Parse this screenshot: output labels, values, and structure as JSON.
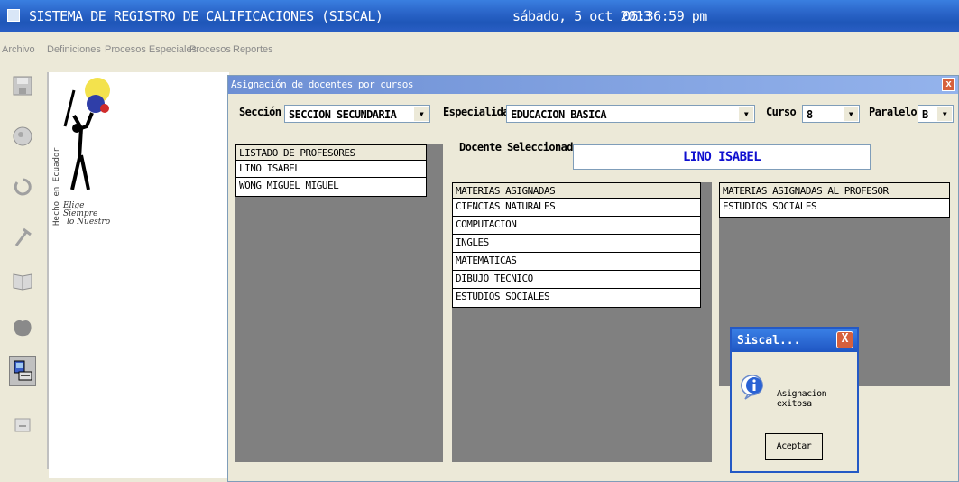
{
  "titlebar": {
    "title": "SISTEMA DE REGISTRO DE CALIFICACIONES  (SISCAL)",
    "date": "sábado, 5 oct 2013",
    "time": "06:36:59 pm"
  },
  "menu": {
    "items": [
      "Archivo",
      "Definiciones",
      "Procesos Especiales",
      "Procesos",
      "Reportes"
    ]
  },
  "toolbar": {
    "icons": [
      "save-icon",
      "user-icon",
      "refresh-icon",
      "tools-icon",
      "book-icon",
      "map-icon",
      "computer-icon",
      "exit-icon"
    ]
  },
  "logo": {
    "vertical_text": "Hecho en Ecuador",
    "slogan_line1": "Elige Siempre",
    "slogan_line2": "lo Nuestro"
  },
  "child_window": {
    "title": "Asignación de docentes por cursos",
    "close": "x",
    "seccion_label": "Sección",
    "seccion_value": "SECCION SECUNDARIA",
    "especialidad_label": "Especialidad",
    "especialidad_value": "EDUCACION BASICA",
    "curso_label": "Curso",
    "curso_value": "8",
    "paralelo_label": "Paralelo",
    "paralelo_value": "B",
    "docente_label": "Docente Seleccionado",
    "docente_value": "LINO ISABEL"
  },
  "profesores": {
    "header": "LISTADO DE PROFESORES",
    "rows": [
      "LINO ISABEL",
      "WONG MIGUEL MIGUEL"
    ]
  },
  "materias": {
    "header": "MATERIAS ASIGNADAS",
    "rows": [
      "CIENCIAS NATURALES",
      "COMPUTACION",
      "INGLES",
      "MATEMATICAS",
      "DIBUJO TECNICO",
      "ESTUDIOS SOCIALES"
    ]
  },
  "materias_profesor": {
    "header": "MATERIAS ASIGNADAS AL PROFESOR",
    "rows": [
      "ESTUDIOS SOCIALES"
    ]
  },
  "dialog": {
    "title": "Siscal...",
    "message": "Asignacion exitosa",
    "ok": "Aceptar",
    "close": "X"
  },
  "colors": {
    "title_blue": "#2a64c8",
    "panel_gray": "#808080",
    "selected_text": "#1010d0"
  }
}
